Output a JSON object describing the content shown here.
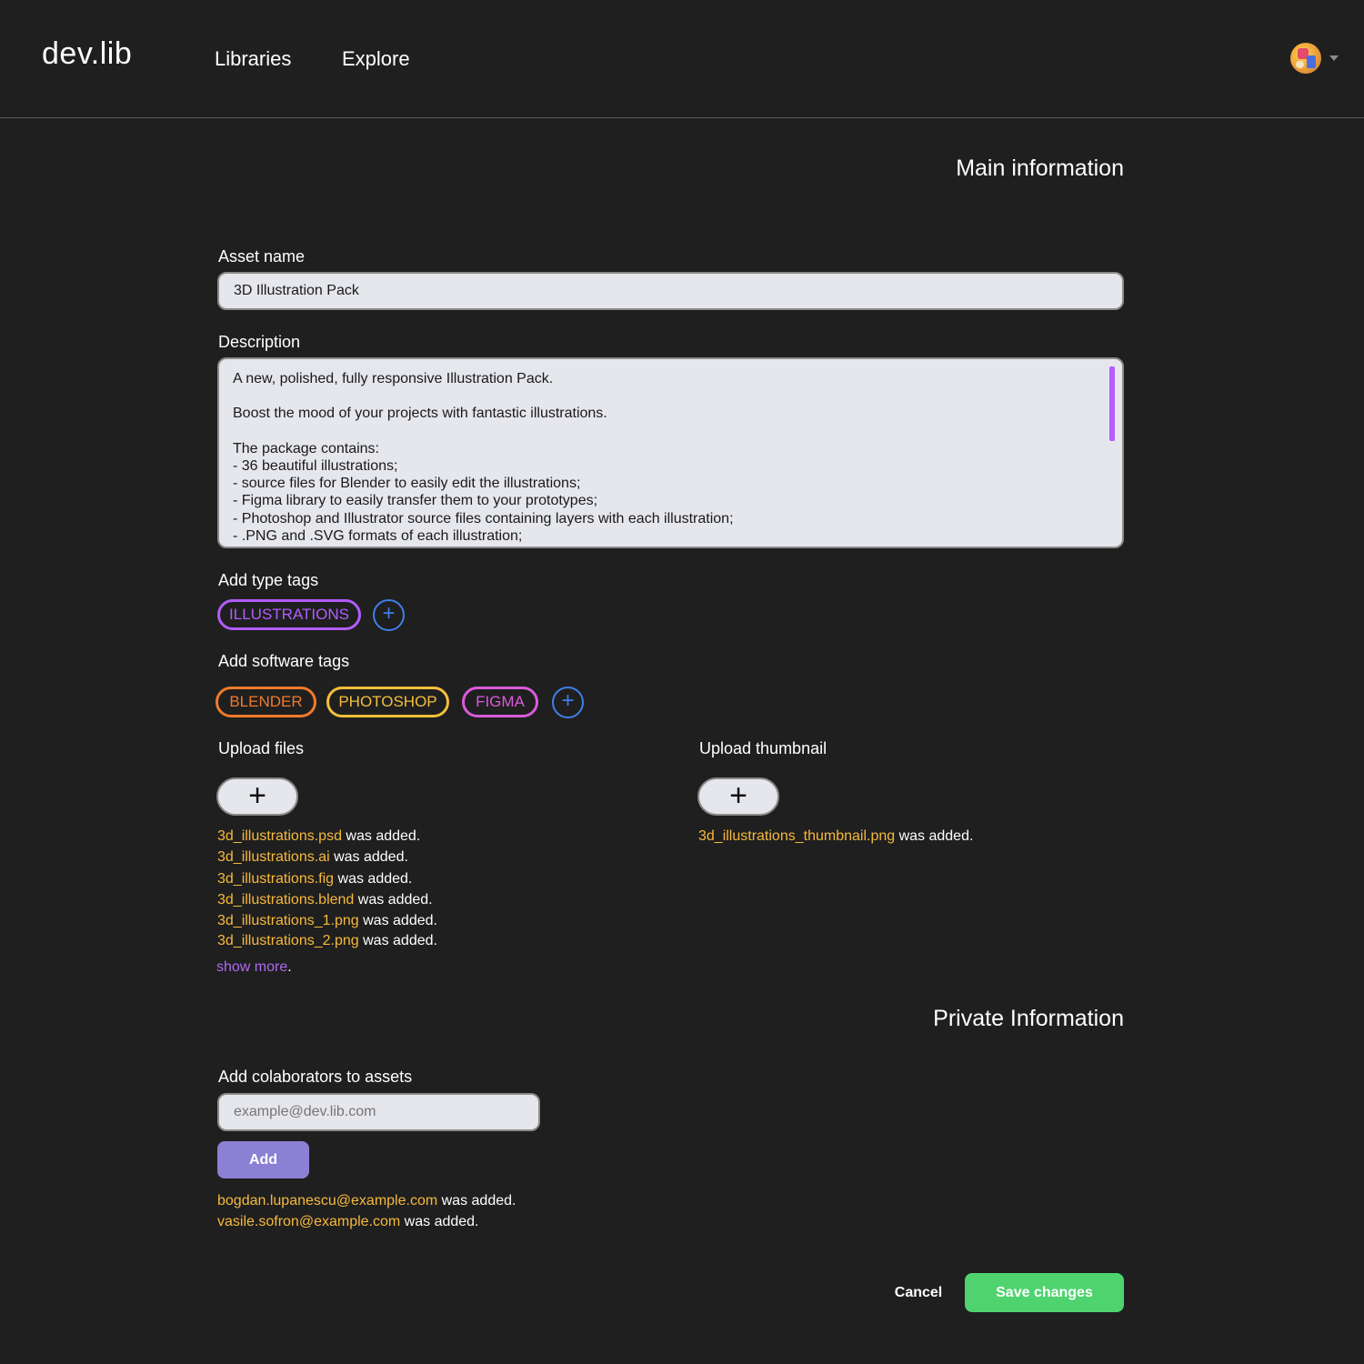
{
  "header": {
    "logo": "dev.lib",
    "nav": [
      "Libraries",
      "Explore"
    ],
    "avatar_icon": "user-avatar"
  },
  "main_info": {
    "title": "Main information",
    "asset_name_label": "Asset name",
    "asset_name_value": "3D Illustration Pack",
    "description_label": "Description",
    "description_value": "A new, polished, fully responsive Illustration Pack.\n\nBoost the mood of your projects with fantastic illustrations.\n\nThe package contains:\n- 36 beautiful illustrations;\n- source files for Blender to easily edit the illustrations;\n- Figma library to easily transfer them to your prototypes;\n- Photoshop and Illustrator source files containing layers with each illustration;\n- .PNG and .SVG formats of each illustration;",
    "type_tags_label": "Add type tags",
    "type_tags": [
      {
        "label": "ILLUSTRATIONS",
        "color": "#b25cff"
      }
    ],
    "software_tags_label": "Add software tags",
    "software_tags": [
      {
        "label": "BLENDER",
        "color": "#f07a2a"
      },
      {
        "label": "PHOTOSHOP",
        "color": "#f5bf3c"
      },
      {
        "label": "FIGMA",
        "color": "#d95bd9"
      }
    ],
    "add_icon": "+",
    "upload_files_label": "Upload files",
    "upload_thumbnail_label": "Upload thumbnail",
    "upload_icon": "+",
    "added_suffix": " was added.",
    "files": [
      "3d_illustrations.psd",
      "3d_illustrations.ai",
      "3d_illustrations.fig",
      "3d_illustrations.blend",
      "3d_illustrations_1.png",
      "3d_illustrations_2.png"
    ],
    "show_more": "show more",
    "show_more_suffix": ".",
    "thumbnail_file": "3d_illustrations_thumbnail.png"
  },
  "private_info": {
    "title": "Private Information",
    "collaborators_label": "Add colaborators to assets",
    "collaborator_placeholder": "example@dev.lib.com",
    "add_button": "Add",
    "collaborators": [
      "bogdan.lupanescu@example.com",
      "vasile.sofron@example.com"
    ]
  },
  "footer": {
    "cancel": "Cancel",
    "save": "Save changes"
  },
  "colors": {
    "background": "#1f1f1f",
    "accent_file": "#f7b93c",
    "accent_link": "#b069f2",
    "add_button": "#8b80d4",
    "save_button": "#4fd36f",
    "plus_circle": "#3f7fe8"
  }
}
